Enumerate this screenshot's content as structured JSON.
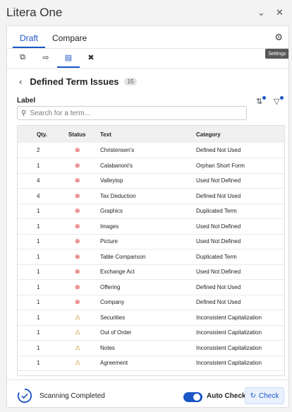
{
  "app": {
    "title": "Litera One"
  },
  "window_controls": {
    "collapse_icon": "chevron-down-icon",
    "close_icon": "close-icon"
  },
  "tabs": [
    {
      "label": "Draft",
      "active": true
    },
    {
      "label": "Compare",
      "active": false
    }
  ],
  "settings": {
    "tooltip": "Settings",
    "icon": "gear-icon"
  },
  "toolbar": {
    "tools": [
      {
        "name": "compare-documents-icon",
        "active": false
      },
      {
        "name": "document-arrow-icon",
        "active": false
      },
      {
        "name": "defined-terms-icon",
        "active": true
      },
      {
        "name": "tools-icon",
        "active": false
      }
    ]
  },
  "panel": {
    "title": "Defined Term Issues",
    "count": "15"
  },
  "filter": {
    "label": "Label"
  },
  "search": {
    "placeholder": "Search for a term..."
  },
  "table": {
    "headers": {
      "qty": "Qty.",
      "status": "Status",
      "text": "Text",
      "category": "Category"
    },
    "rows": [
      {
        "qty": "2",
        "status": "error",
        "text": "Christensen's",
        "category": "Defined Not Used"
      },
      {
        "qty": "1",
        "status": "error",
        "text": "Calabanoni's",
        "category": "Orphan Short Form"
      },
      {
        "qty": "4",
        "status": "error",
        "text": "Valleytop",
        "category": "Used Not Defined"
      },
      {
        "qty": "4",
        "status": "error",
        "text": "Tax Deduction",
        "category": "Defined Not Used"
      },
      {
        "qty": "1",
        "status": "error",
        "text": "Graphics",
        "category": "Duplicated Term"
      },
      {
        "qty": "1",
        "status": "error",
        "text": "Images",
        "category": "Used Not Defined"
      },
      {
        "qty": "1",
        "status": "error",
        "text": "Picture",
        "category": "Used Not Defined"
      },
      {
        "qty": "1",
        "status": "error",
        "text": "Table Comparison",
        "category": "Duplicated Term"
      },
      {
        "qty": "1",
        "status": "error",
        "text": "Exchange Act",
        "category": "Used Not Defined"
      },
      {
        "qty": "1",
        "status": "error",
        "text": "Offering",
        "category": "Defined Not Used"
      },
      {
        "qty": "1",
        "status": "error",
        "text": "Company",
        "category": "Defined Not Used"
      },
      {
        "qty": "1",
        "status": "warning",
        "text": "Securities",
        "category": "Inconsistent Capitalization"
      },
      {
        "qty": "1",
        "status": "warning",
        "text": "Out of Order",
        "category": "Inconsistent Capitalization"
      },
      {
        "qty": "1",
        "status": "warning",
        "text": "Notes",
        "category": "Inconsistent Capitalization"
      },
      {
        "qty": "1",
        "status": "warning",
        "text": "Agreement",
        "category": "Inconsistent Capitalization"
      }
    ]
  },
  "footer": {
    "scan_status": "Scanning Completed",
    "auto_check_label": "Auto Check",
    "auto_check_on": true,
    "check_label": "Check"
  },
  "colors": {
    "accent": "#1a56c5",
    "error": "#d9302f",
    "warning": "#b8860b"
  }
}
